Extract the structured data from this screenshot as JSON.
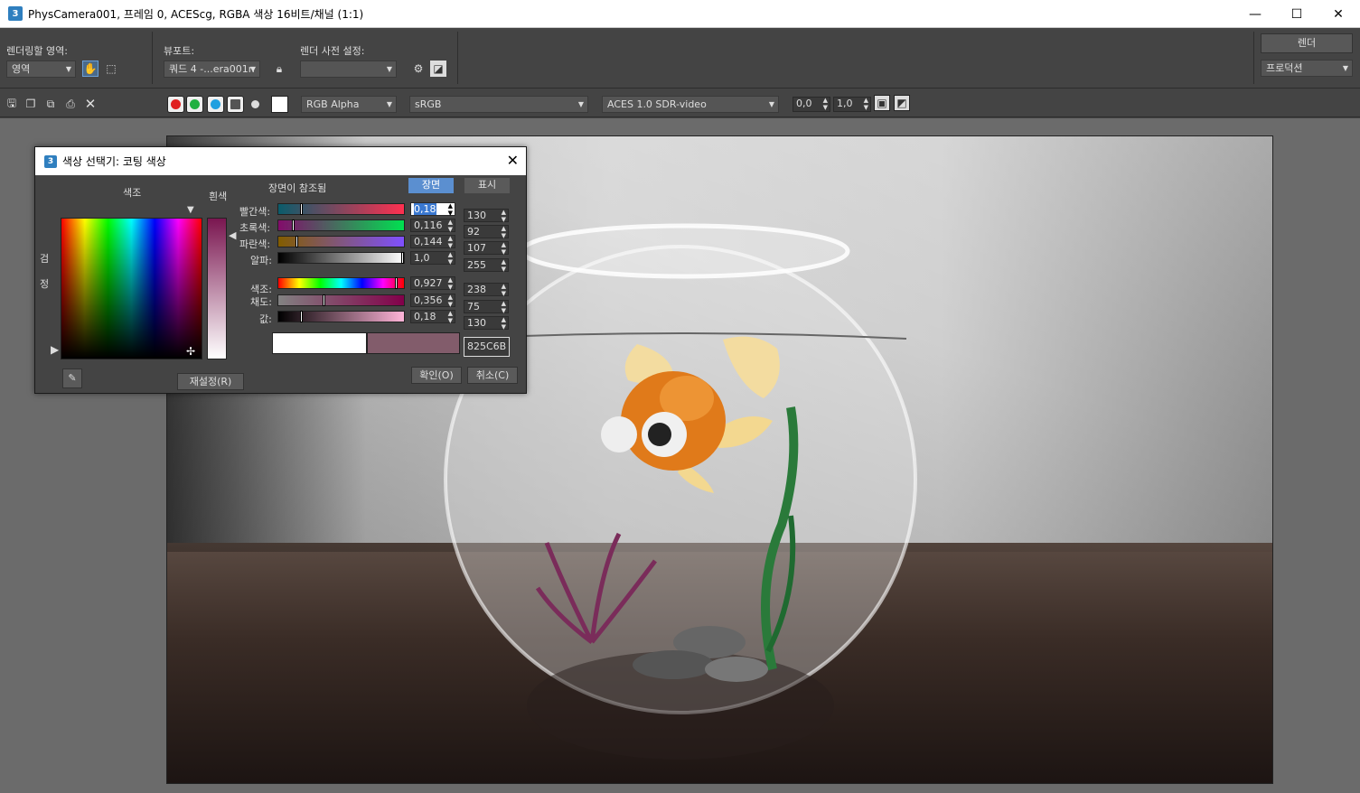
{
  "window": {
    "title": "PhysCamera001, 프레임 0, ACEScg, RGBA 색상 16비트/채널 (1:1)",
    "app_icon": "3",
    "minimize": "—",
    "maximize": "☐",
    "close": "✕"
  },
  "row1": {
    "render_area_label": "렌더링할 영역:",
    "render_area_value": "영역",
    "viewport_label": "뷰포트:",
    "viewport_value": "쿼드 4 -...era001n",
    "preset_label": "렌더 사전 설정:",
    "preset_value": "",
    "render_button": "렌더",
    "production_value": "프로덕션"
  },
  "row2": {
    "channel_value": "RGB Alpha",
    "colorspace_value": "sRGB",
    "display_value": "ACES 1.0 SDR-video",
    "exposure_value": "0,0",
    "gamma_value": "1,0"
  },
  "dialog": {
    "title": "색상 선택기: 코팅 색상",
    "hue_label": "색조",
    "white_label": "흰색",
    "black_label_1": "검",
    "black_label_2": "정",
    "scene_ref_label": "장면이 참조됨",
    "tab_scene": "장면",
    "tab_display": "표시",
    "rows": [
      {
        "label": "빨간색:",
        "value": "0,18",
        "int": "130"
      },
      {
        "label": "초록색:",
        "value": "0,116",
        "int": "92"
      },
      {
        "label": "파란색:",
        "value": "0,144",
        "int": "107"
      },
      {
        "label": "알파:",
        "value": "1,0",
        "int": "255"
      },
      {
        "label": "색조:",
        "value": "0,927",
        "int": "238"
      },
      {
        "label": "채도:",
        "value": "0,356",
        "int": "75"
      },
      {
        "label": "값:",
        "value": "0,18",
        "int": "130"
      }
    ],
    "hex_value": "825C6B",
    "reset_button": "재설정(R)",
    "ok_button": "확인(O)",
    "cancel_button": "취소(C)",
    "old_color": "#ffffff",
    "new_color": "#825C6B"
  }
}
